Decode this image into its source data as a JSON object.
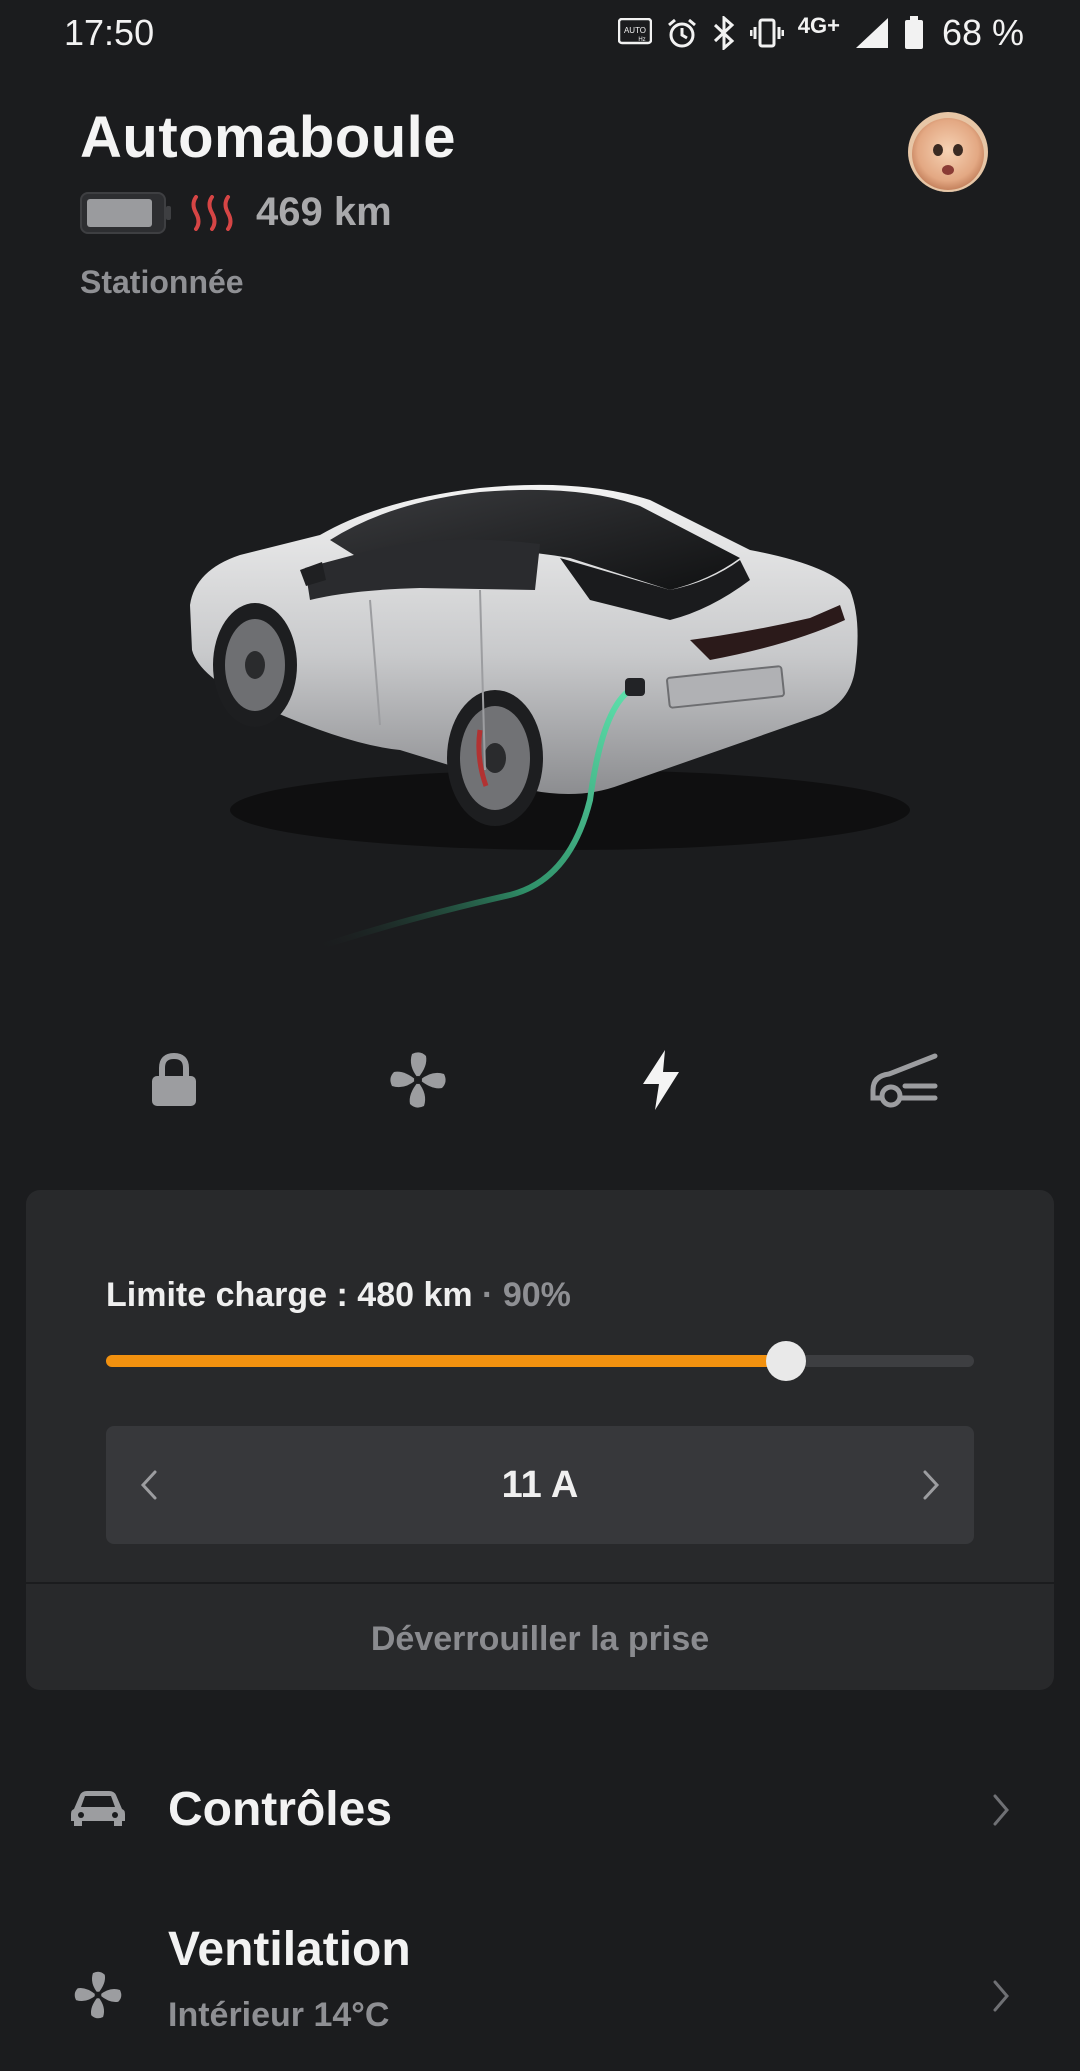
{
  "status_bar": {
    "time": "17:50",
    "battery_percent": "68 %",
    "network": "4G+"
  },
  "vehicle": {
    "name": "Automaboule",
    "range": "469 km",
    "state": "Stationnée",
    "battery_level": 0.9
  },
  "quick_actions": [
    {
      "name": "lock-icon"
    },
    {
      "name": "fan-icon"
    },
    {
      "name": "lightning-icon"
    },
    {
      "name": "frunk-icon"
    }
  ],
  "charging": {
    "limit_label": "Limite charge : 480 km",
    "limit_separator": " · ",
    "limit_percent": "90%",
    "limit_value": 0.9,
    "amperage": "11 A",
    "unlock_label": "Déverrouiller la prise"
  },
  "menu": {
    "controls": {
      "title": "Contrôles"
    },
    "ventilation": {
      "title": "Ventilation",
      "subtitle": "Intérieur 14°C"
    }
  },
  "colors": {
    "accent": "#f2910f",
    "heat": "#d64545",
    "cable": "#3fc58f",
    "background": "#1b1c1e",
    "card": "#28292b"
  }
}
